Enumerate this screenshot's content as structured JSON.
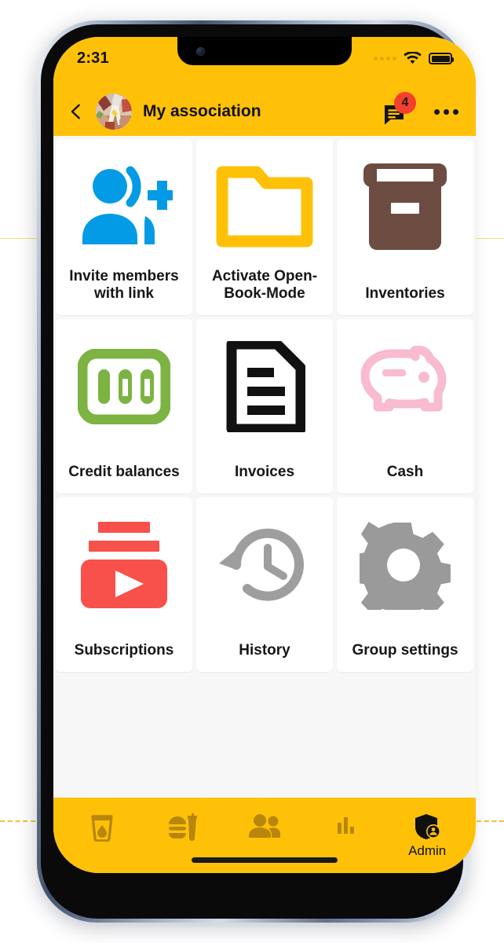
{
  "status_bar": {
    "time": "2:31",
    "cellular_icon": "signal-dots-icon",
    "wifi_icon": "wifi-icon",
    "battery_icon": "battery-full-icon"
  },
  "app_bar": {
    "back_icon": "back-chevron-icon",
    "avatar_icon": "group-photo-avatar",
    "title": "My association",
    "chat_icon": "chat-bubble-icon",
    "chat_badge_count": "4",
    "overflow_icon": "more-options-icon"
  },
  "grid": {
    "tiles": [
      {
        "label": "Invite members with link",
        "icon": "person-add-icon",
        "color": "#039be5"
      },
      {
        "label": "Activate Open-Book-Mode",
        "icon": "folder-open-icon",
        "color": "#ffc107"
      },
      {
        "label": "Inventories",
        "icon": "inventory-box-icon",
        "color": "#6d4c41"
      },
      {
        "label": "Credit balances",
        "icon": "money-100-icon",
        "color": "#7cb342"
      },
      {
        "label": "Invoices",
        "icon": "invoice-document-icon",
        "color": "#111111"
      },
      {
        "label": "Cash",
        "icon": "piggy-bank-icon",
        "color": "#f8bbd0"
      },
      {
        "label": "Subscriptions",
        "icon": "subscriptions-icon",
        "color": "#f8504a"
      },
      {
        "label": "History",
        "icon": "history-clock-icon",
        "color": "#9e9e9e"
      },
      {
        "label": "Group settings",
        "icon": "gear-settings-icon",
        "color": "#9a9a9a"
      }
    ]
  },
  "bottom_nav": {
    "items": [
      {
        "icon": "drink-glass-icon",
        "label": ""
      },
      {
        "icon": "fastfood-icon",
        "label": ""
      },
      {
        "icon": "people-group-icon",
        "label": ""
      },
      {
        "icon": "bar-chart-icon",
        "label": ""
      },
      {
        "icon": "admin-shield-icon",
        "label": "Admin"
      }
    ]
  },
  "theme": {
    "accent": "#ffc107",
    "badge": "#f4402f",
    "surface": "#ffffff",
    "background": "#f7f7f7"
  }
}
